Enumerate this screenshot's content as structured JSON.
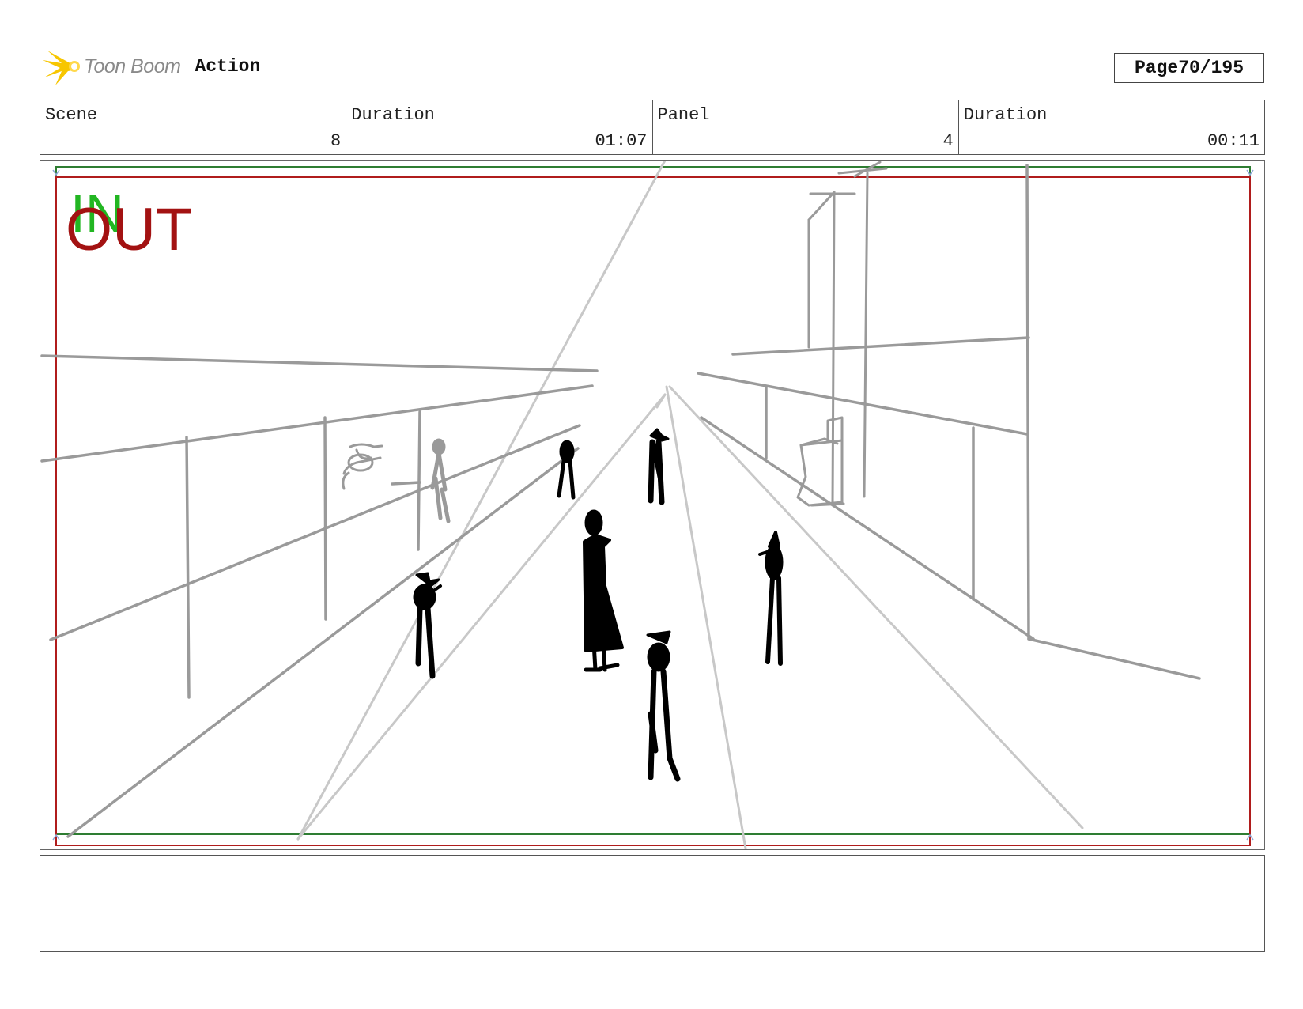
{
  "header": {
    "logo_text": "Toon Boom",
    "section_title": "Action",
    "page_label": "Page",
    "page_value": "70/195"
  },
  "info": {
    "scene_label": "Scene",
    "scene_value": "8",
    "scene_duration_label": "Duration",
    "scene_duration_value": "01:07",
    "panel_label": "Panel",
    "panel_value": "4",
    "panel_duration_label": "Duration",
    "panel_duration_value": "00:11"
  },
  "panel": {
    "in_label": "IN",
    "out_label": "OUT",
    "safe_frame_color": "#2e7d32",
    "camera_frame_color": "#b01c1c"
  },
  "notes": {
    "action_text": ""
  },
  "colors": {
    "sketch_gray": "#9a9a9a",
    "light_gray": "#c8c8c8",
    "figure": "#000000",
    "logo_star": "#f7c600"
  }
}
